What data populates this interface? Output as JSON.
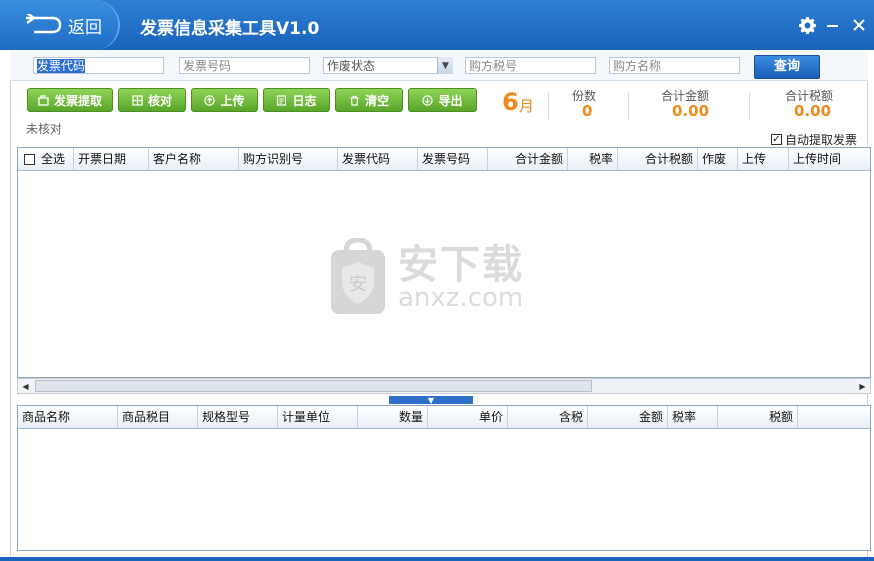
{
  "titlebar": {
    "back_label": "返回",
    "title": "发票信息采集工具V1.0"
  },
  "search": {
    "invoice_code": "发票代码",
    "invoice_number": "发票号码",
    "void_status": "作废状态",
    "buyer_tax_id": "购方税号",
    "buyer_name": "购方名称",
    "query_label": "查询"
  },
  "toolbar": {
    "extract_label": "发票提取",
    "verify_label": "核对",
    "upload_label": "上传",
    "log_label": "日志",
    "clear_label": "清空",
    "export_label": "导出"
  },
  "status": {
    "verify_status": "未核对",
    "month_number": "6",
    "month_unit": "月",
    "count_label": "份数",
    "count_value": "0",
    "total_amount_label": "合计金额",
    "total_amount_value": "0.00",
    "total_tax_label": "合计税额",
    "total_tax_value": "0.00",
    "auto_extract_label": "自动提取发票",
    "auto_extract_checked": true
  },
  "invoice_table": {
    "select_all_label": "全选",
    "columns": [
      "开票日期",
      "客户名称",
      "购方识别号",
      "发票代码",
      "发票号码",
      "合计金额",
      "税率",
      "合计税额",
      "作废",
      "上传",
      "上传时间"
    ]
  },
  "goods_table": {
    "columns": [
      "商品名称",
      "商品税目",
      "规格型号",
      "计量单位",
      "数量",
      "单价",
      "含税",
      "金额",
      "税率",
      "税额"
    ]
  },
  "watermark": {
    "site_cn": "安下载",
    "site_url": "anxz.com"
  },
  "colors": {
    "titlebar": "#1a63bb",
    "accent_orange": "#f08a1c",
    "button_green": "#6cb83a",
    "query_blue": "#2a6ed0"
  }
}
